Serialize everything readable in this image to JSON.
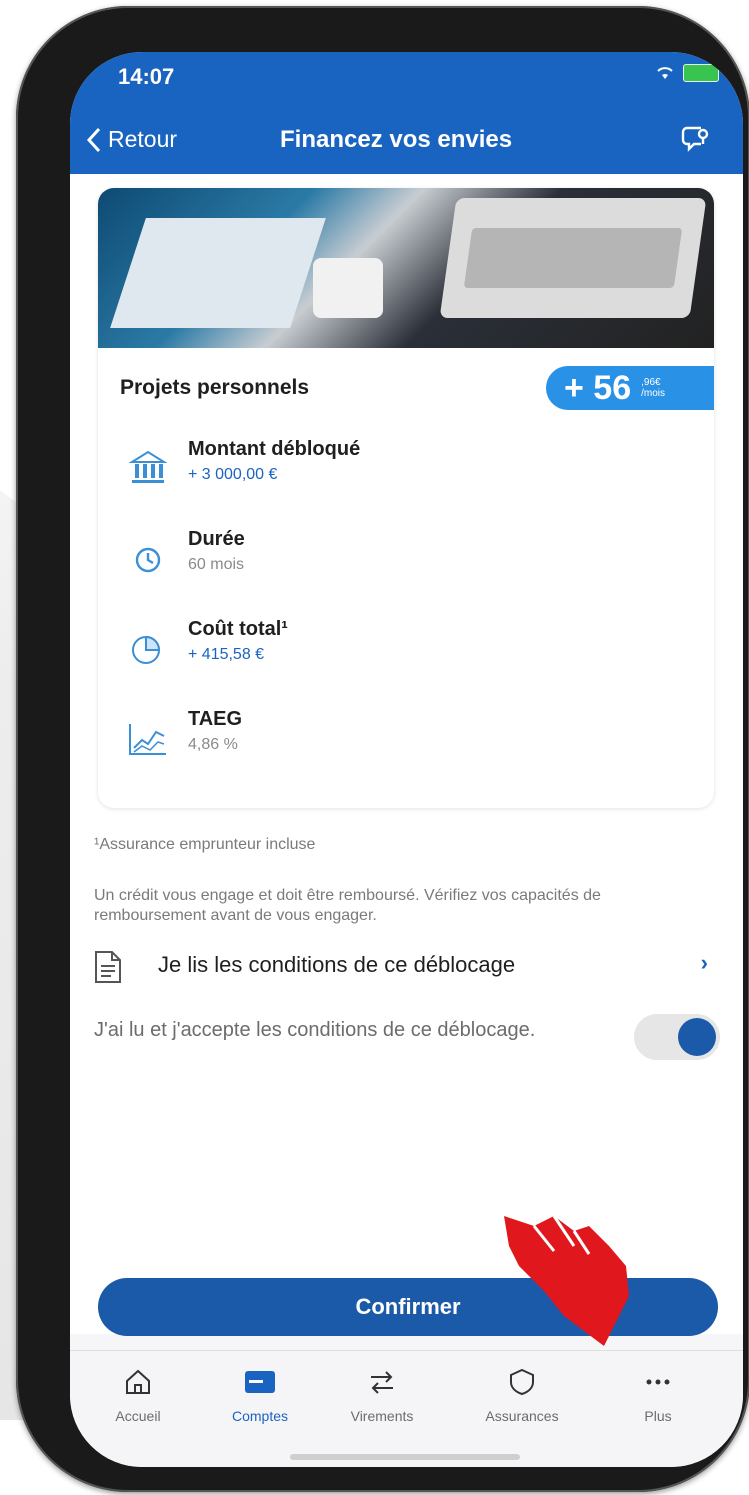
{
  "status": {
    "time": "14:07"
  },
  "nav": {
    "back_label": "Retour",
    "title": "Financez vos envies"
  },
  "card": {
    "title": "Projets personnels",
    "badge": {
      "amount": "+ 56",
      "cents": ",96€",
      "per": "/mois"
    },
    "rows": [
      {
        "label": "Montant débloqué",
        "value": "+ 3 000,00 €",
        "icon": "bank-icon"
      },
      {
        "label": "Durée",
        "value": "60 mois",
        "icon": "clock-icon"
      },
      {
        "label": "Coût total¹",
        "value": "+ 415,58 €",
        "icon": "pie-chart-icon"
      },
      {
        "label": "TAEG",
        "value": "4,86 %",
        "icon": "line-chart-icon"
      }
    ]
  },
  "footnote": "¹Assurance emprunteur incluse",
  "disclaimer": "Un crédit vous engage et doit être remboursé. Vérifiez vos capacités de remboursement avant de vous engager.",
  "conditions": {
    "label": "Je lis les conditions de ce déblocage"
  },
  "accept": {
    "label": "J'ai lu et j'accepte les conditions de ce déblocage.",
    "toggle_on": true
  },
  "confirm_label": "Confirmer",
  "tabs": [
    {
      "label": "Accueil",
      "icon": "home-icon",
      "active": false
    },
    {
      "label": "Comptes",
      "icon": "card-icon",
      "active": true
    },
    {
      "label": "Virements",
      "icon": "transfer-icon",
      "active": false
    },
    {
      "label": "Assurances",
      "icon": "shield-icon",
      "active": false
    },
    {
      "label": "Plus",
      "icon": "more-icon",
      "active": false
    }
  ],
  "colors": {
    "primary": "#1a64c1",
    "button": "#1a5aa8",
    "badge": "#2a92e6",
    "hand": "#e0171d"
  }
}
